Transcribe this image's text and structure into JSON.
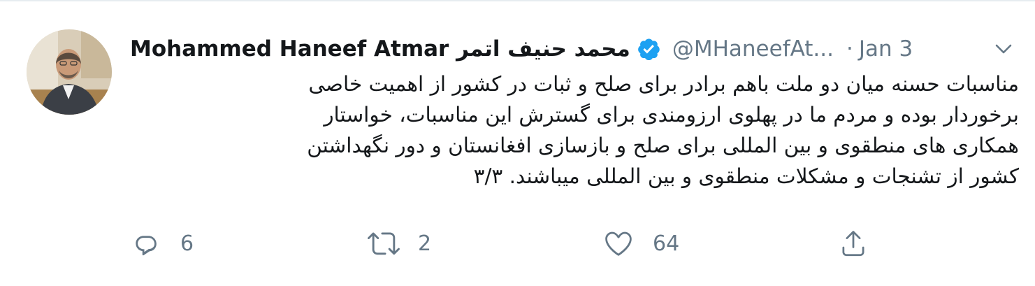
{
  "tweet": {
    "author": {
      "display_name": "Mohammed Haneef Atmar محمد حنیف اتمر",
      "handle": "@MHaneefAt...",
      "verified": true,
      "avatar_icon": "profile-photo"
    },
    "separator": "·",
    "date": "Jan 3",
    "text": "مناسبات حسنه میان دو ملت باهم برادر برای صلح و ثبات در کشور از اهمیت خاصی\nبرخوردار بوده و مردم ما در پهلوی ارزومندی برای گسترش این مناسبات، خواستار\nهمکاری های منطقوی و بین المللی برای صلح و بازسازی افغانستان و دور نگهداشتن\nکشور از تشنجات و مشکلات منطقوی و بین المللی میباشند. ۳/۳",
    "actions": {
      "reply": {
        "icon": "reply-icon",
        "count": "6"
      },
      "retweet": {
        "icon": "retweet-icon",
        "count": "2"
      },
      "like": {
        "icon": "heart-icon",
        "count": "64"
      },
      "share": {
        "icon": "share-icon"
      }
    }
  },
  "colors": {
    "text_primary": "#14171a",
    "text_secondary": "#657786",
    "verified_blue": "#1da1f2",
    "border": "#e6ecf0"
  }
}
